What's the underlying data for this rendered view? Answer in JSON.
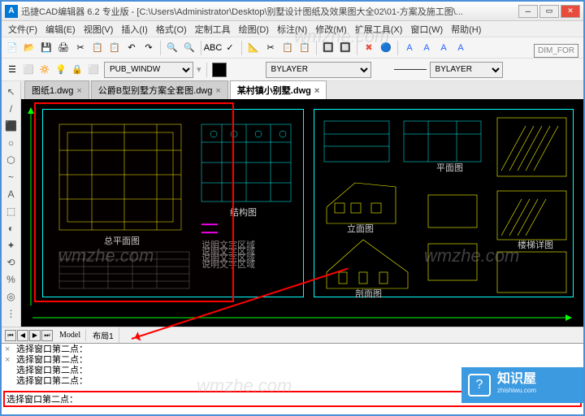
{
  "titlebar": {
    "app": "A",
    "title": "迅捷CAD编辑器 6.2 专业版  -  [C:\\Users\\Administrator\\Desktop\\别墅设计图纸及效果图大全02\\01-方案及施工图\\..."
  },
  "menu": [
    "文件(F)",
    "编辑(E)",
    "视图(V)",
    "插入(I)",
    "格式(O)",
    "定制工具",
    "绘图(D)",
    "标注(N)",
    "修改(M)",
    "扩展工具(X)",
    "窗口(W)",
    "帮助(H)"
  ],
  "toolbar_icons": [
    "📄",
    "📂",
    "💾",
    "🖨",
    "✂",
    "📋",
    "📋",
    "↶",
    "↷",
    "|",
    "🔍",
    "🔍",
    "|",
    "ABC",
    "✓",
    "|",
    "📐",
    "✂",
    "📋",
    "📋",
    "|",
    "🔲",
    "🔲",
    "|",
    "✖",
    "🔵",
    "|",
    "A",
    "A",
    "A",
    "A"
  ],
  "dimfor": "DIM_FOR",
  "propbar": {
    "layer_icons": [
      "☰",
      "⬜",
      "🔅",
      "💡",
      "🔒",
      "⬜"
    ],
    "layer": "PUB_WINDW",
    "linetype": "BYLAYER",
    "lineweight": "BYLAYER"
  },
  "tabs": [
    {
      "label": "图纸1.dwg",
      "active": false
    },
    {
      "label": "公爵B型别墅方案全套图.dwg",
      "active": false
    },
    {
      "label": "某村镇小别墅.dwg",
      "active": true
    }
  ],
  "left_tools": [
    "↖",
    "/",
    "⬛",
    "○",
    "⬡",
    "~",
    "A",
    "⬚",
    "◐",
    "✦",
    "⟲",
    "%",
    "◎",
    "⋮"
  ],
  "bottom_tabs": {
    "model": "Model",
    "layout": "布局1"
  },
  "cmd": {
    "history": [
      "选择窗口第二点：",
      "选择窗口第二点：",
      "选择窗口第二点：",
      "选择窗口第二点："
    ],
    "prompt": "选择窗口第二点："
  },
  "badge": {
    "title": "知识屋",
    "url": "zhishiwu.com"
  },
  "watermarks": [
    "wmzhe.com",
    "wmzhe.com",
    "wmzhe.com",
    "wmzhe.com"
  ]
}
